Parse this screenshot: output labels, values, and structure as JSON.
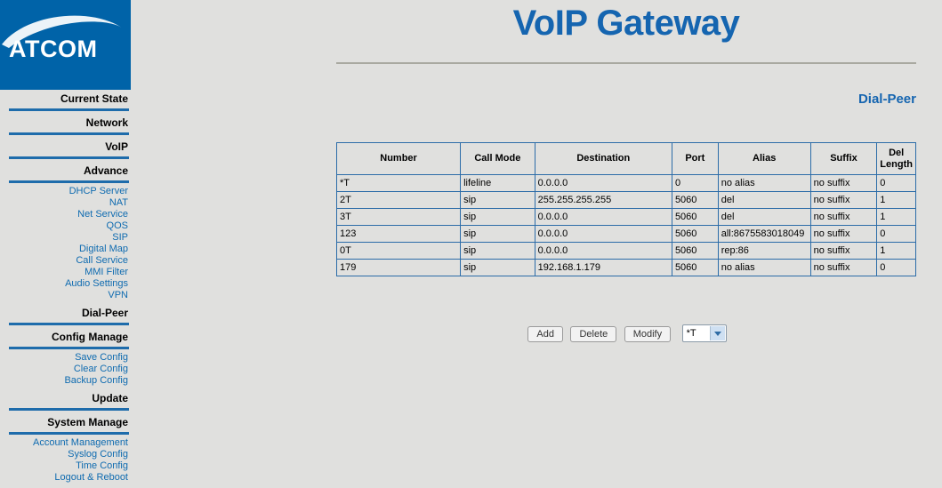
{
  "brand": {
    "logo_text": "ATCOM",
    "logo_bg": "#0063a8",
    "accent": "#1565b0"
  },
  "header": {
    "title": "VoIP Gateway",
    "section": "Dial-Peer"
  },
  "sidebar": {
    "groups": [
      {
        "header": "Current State",
        "links": []
      },
      {
        "header": "Network",
        "links": []
      },
      {
        "header": "VoIP",
        "links": []
      },
      {
        "header": "Advance",
        "links": [
          "DHCP Server",
          "NAT",
          "Net Service",
          "QOS",
          "SIP",
          "Digital Map",
          "Call Service",
          "MMI Filter",
          "Audio Settings",
          "VPN"
        ]
      },
      {
        "header": "Dial-Peer",
        "links": []
      },
      {
        "header": "Config Manage",
        "links": [
          "Save Config",
          "Clear Config",
          "Backup Config"
        ]
      },
      {
        "header": "Update",
        "links": []
      },
      {
        "header": "System Manage",
        "links": [
          "Account Management",
          "Syslog Config",
          "Time Config",
          "Logout & Reboot"
        ]
      }
    ]
  },
  "table": {
    "columns": [
      "Number",
      "Call Mode",
      "Destination",
      "Port",
      "Alias",
      "Suffix",
      "Del Length"
    ],
    "rows": [
      {
        "number": "*T",
        "call_mode": "lifeline",
        "destination": "0.0.0.0",
        "port": "0",
        "alias": "no alias",
        "suffix": "no suffix",
        "del_length": "0"
      },
      {
        "number": "2T",
        "call_mode": "sip",
        "destination": "255.255.255.255",
        "port": "5060",
        "alias": "del",
        "suffix": "no suffix",
        "del_length": "1"
      },
      {
        "number": "3T",
        "call_mode": "sip",
        "destination": "0.0.0.0",
        "port": "5060",
        "alias": "del",
        "suffix": "no suffix",
        "del_length": "1"
      },
      {
        "number": "123",
        "call_mode": "sip",
        "destination": "0.0.0.0",
        "port": "5060",
        "alias": "all:8675583018049",
        "suffix": "no suffix",
        "del_length": "0"
      },
      {
        "number": "0T",
        "call_mode": "sip",
        "destination": "0.0.0.0",
        "port": "5060",
        "alias": "rep:86",
        "suffix": "no suffix",
        "del_length": "1"
      },
      {
        "number": "179",
        "call_mode": "sip",
        "destination": "192.168.1.179",
        "port": "5060",
        "alias": "no alias",
        "suffix": "no suffix",
        "del_length": "0"
      }
    ]
  },
  "controls": {
    "add_label": "Add",
    "delete_label": "Delete",
    "modify_label": "Modify",
    "select_value": "*T"
  }
}
